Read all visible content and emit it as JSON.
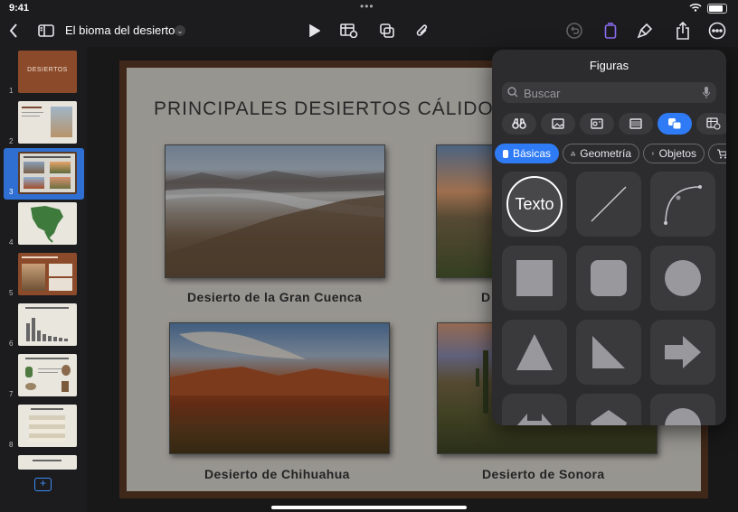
{
  "status_bar": {
    "time": "9:41",
    "more": "•••"
  },
  "toolbar": {
    "back_icon": "chevron-left-icon",
    "document_title": "El bioma del desierto",
    "title_menu_icon": "chevron-down-icon",
    "sidebar_icon": "sidebar-icon",
    "play_icon": "play-icon",
    "table_icon": "table-icon",
    "shapes_icon": "shapes-icon",
    "attach_icon": "paperclip-icon",
    "undo_icon": "undo-icon",
    "format_icon": "format-icon",
    "brush_icon": "paintbrush-icon",
    "share_icon": "share-icon",
    "more_icon": "ellipsis-icon"
  },
  "navigator": {
    "slides": [
      {
        "number": "1",
        "label": "DESIERTOS"
      },
      {
        "number": "2"
      },
      {
        "number": "3"
      },
      {
        "number": "4"
      },
      {
        "number": "5"
      },
      {
        "number": "6"
      },
      {
        "number": "7"
      },
      {
        "number": "8"
      }
    ],
    "selected": "3",
    "add_icon": "plus-icon"
  },
  "slide": {
    "title": "PRINCIPALES DESIERTOS CÁLIDOS D",
    "photos": [
      {
        "caption": "Desierto de la Gran Cuenca"
      },
      {
        "caption": "D"
      },
      {
        "caption": "Desierto de Chihuahua"
      },
      {
        "caption": "Desierto de Sonora"
      }
    ]
  },
  "shapes_popover": {
    "title": "Figuras",
    "search_placeholder": "Buscar",
    "categories": [
      "binoculars-icon",
      "image-icon",
      "photo-collage-icon",
      "texture-icon",
      "shapes-icon",
      "table-icon"
    ],
    "active_category": "shapes-icon",
    "chips": [
      {
        "label": "Básicas",
        "active": true
      },
      {
        "label": "Geometría",
        "active": false
      },
      {
        "label": "Objetos",
        "active": false
      }
    ],
    "tiles": [
      {
        "name": "text-shape",
        "label": "Texto"
      },
      {
        "name": "line-shape"
      },
      {
        "name": "curve-shape"
      },
      {
        "name": "square-shape"
      },
      {
        "name": "rounded-square-shape"
      },
      {
        "name": "circle-shape"
      },
      {
        "name": "triangle-shape"
      },
      {
        "name": "right-triangle-shape"
      },
      {
        "name": "arrow-shape"
      },
      {
        "name": "double-arrow-shape"
      },
      {
        "name": "pentagon-shape"
      },
      {
        "name": "semicircle-shape"
      }
    ]
  },
  "colors": {
    "accent": "#2f7bf5",
    "slide_frame": "#5b3a24",
    "slide_bg": "#d9d6cf",
    "popover_bg": "#2c2c2e"
  }
}
